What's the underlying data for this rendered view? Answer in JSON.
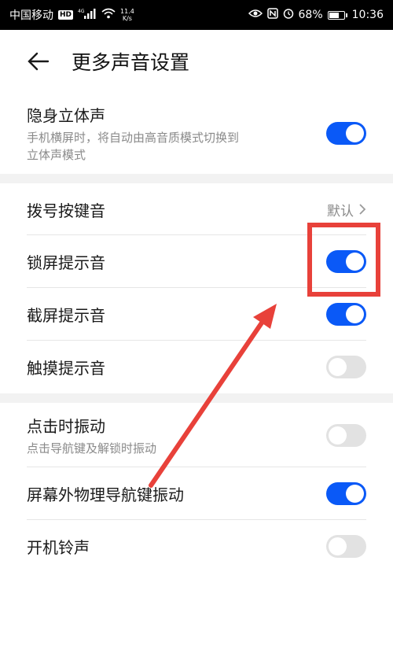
{
  "status_bar": {
    "carrier": "中国移动",
    "hd": "HD",
    "network": "4G",
    "speed_value": "11.4",
    "speed_unit": "K/s",
    "battery_percent": "68%",
    "battery_level": 0.68,
    "time": "10:36",
    "icons": [
      "eye-icon",
      "nfc-icon",
      "alarm-icon",
      "battery-icon",
      "wifi-icon",
      "signal-icon"
    ]
  },
  "header": {
    "title": "更多声音设置",
    "back_icon": "arrow-left-icon"
  },
  "settings": {
    "stereo": {
      "label": "隐身立体声",
      "sub_line1": "手机横屏时，将自动由高音质模式切换到",
      "sub_line2": "立体声模式",
      "on": true
    },
    "dial": {
      "label": "拨号按键音",
      "value": "默认"
    },
    "lock": {
      "label": "锁屏提示音",
      "on": true
    },
    "screenshot": {
      "label": "截屏提示音",
      "on": true
    },
    "touch": {
      "label": "触摸提示音",
      "on": false
    },
    "vibrate": {
      "label": "点击时振动",
      "sub": "点击导航键及解锁时振动",
      "on": false
    },
    "nav_vibrate": {
      "label": "屏幕外物理导航键振动",
      "on": true
    },
    "boot": {
      "label": "开机铃声",
      "on": false
    }
  },
  "annotation": {
    "color": "#e8413a"
  },
  "colors": {
    "toggle_on": "#0a59f7",
    "toggle_off": "#e2e2e2"
  }
}
